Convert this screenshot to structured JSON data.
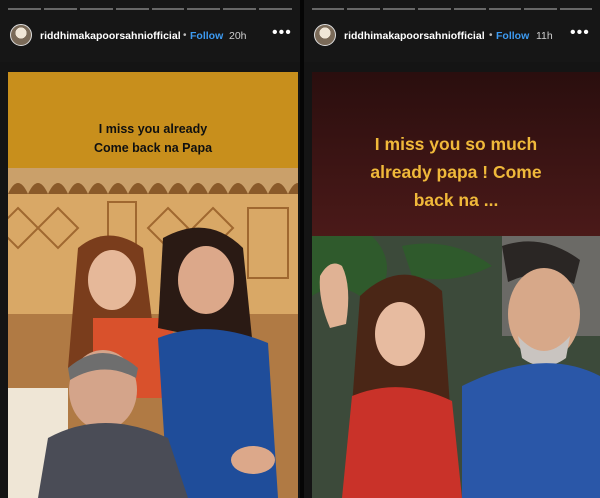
{
  "stories": [
    {
      "username": "riddhimakapoorsahniofficial",
      "separator": "•",
      "follow_label": "Follow",
      "time": "20h",
      "more": "•••",
      "caption_lines": [
        "I miss you already",
        "Come back na Papa"
      ],
      "photo": "family-photo-restaurant"
    },
    {
      "username": "riddhimakapoorsahniofficial",
      "separator": "•",
      "follow_label": "Follow",
      "time": "11h",
      "more": "•••",
      "caption_lines": [
        "I miss you so much",
        "already papa ! Come",
        "back na  ..."
      ],
      "photo": "father-daughter-photo"
    }
  ],
  "colors": {
    "story1_bg": "#c88f1c",
    "story2_caption": "#f0b93a",
    "follow": "#3d9bf2"
  }
}
